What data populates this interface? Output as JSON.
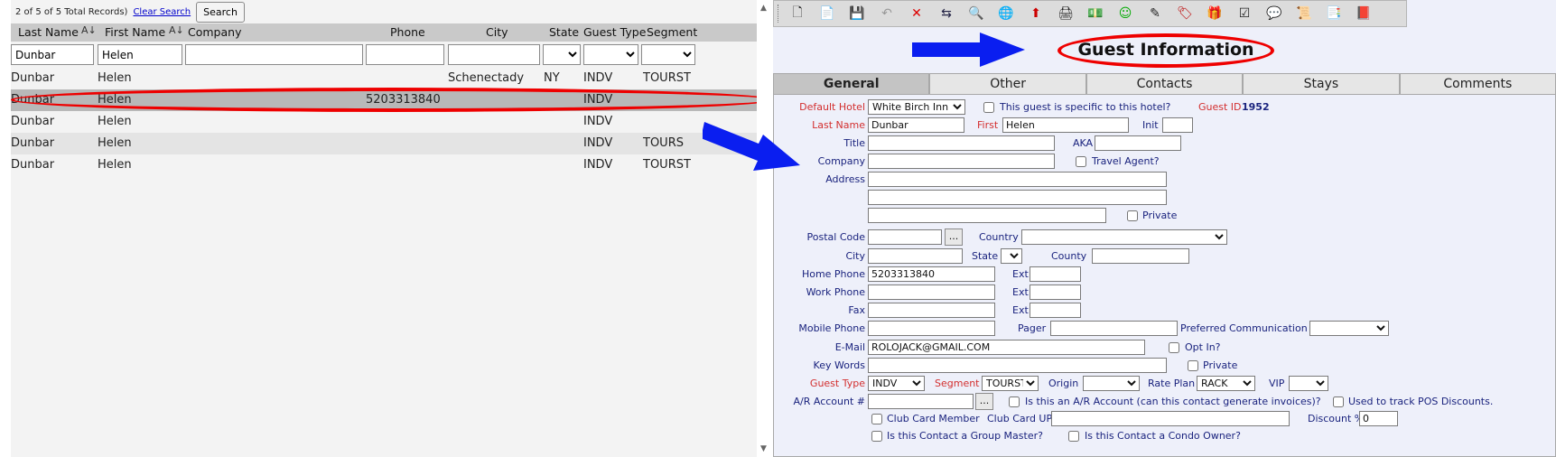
{
  "left": {
    "record_info": "2 of 5 of 5 Total Records)",
    "clear_search": "Clear Search",
    "search_button": "Search",
    "columns": [
      "Last Name",
      "First Name",
      "Company",
      "Phone",
      "City",
      "State",
      "Guest Type",
      "Segment"
    ],
    "filters": {
      "last_name": "Dunbar",
      "first_name": "Helen"
    },
    "rows": [
      {
        "last": "Dunbar",
        "first": "Helen",
        "company": "",
        "phone": "",
        "city": "Schenectady",
        "state": "NY",
        "type": "INDV",
        "segment": "TOURST"
      },
      {
        "last": "Dunbar",
        "first": "Helen",
        "company": "",
        "phone": "5203313840",
        "city": "",
        "state": "",
        "type": "INDV",
        "segment": ""
      },
      {
        "last": "Dunbar",
        "first": "Helen",
        "company": "",
        "phone": "",
        "city": "",
        "state": "",
        "type": "INDV",
        "segment": ""
      },
      {
        "last": "Dunbar",
        "first": "Helen",
        "company": "",
        "phone": "",
        "city": "",
        "state": "",
        "type": "INDV",
        "segment": "TOURS"
      },
      {
        "last": "Dunbar",
        "first": "Helen",
        "company": "",
        "phone": "",
        "city": "",
        "state": "",
        "type": "INDV",
        "segment": "TOURST"
      }
    ]
  },
  "right": {
    "title": "Guest Information",
    "toolbar_icons": [
      "new-icon",
      "copy-icon",
      "save-icon",
      "undo-icon",
      "delete-icon",
      "merge-icon",
      "find-icon",
      "globe-icon",
      "export-icon",
      "print-icon",
      "money-icon",
      "smiley-icon",
      "wand-icon",
      "tag-icon",
      "gift-icon",
      "checklist-icon",
      "comment-icon",
      "scroll-icon",
      "documents-icon",
      "book-icon"
    ],
    "tabs": [
      "General",
      "Other",
      "Contacts",
      "Stays",
      "Comments"
    ],
    "form": {
      "default_hotel_label": "Default Hotel",
      "default_hotel_value": "White Birch Inn",
      "specific_label": "This guest is specific to this hotel?",
      "guest_id_label": "Guest ID",
      "guest_id_value": "1952",
      "last_name_label": "Last Name",
      "last_name_value": "Dunbar",
      "first_label": "First",
      "first_value": "Helen",
      "init_label": "Init",
      "title_label": "Title",
      "aka_label": "AKA",
      "company_label": "Company",
      "travel_agent_label": "Travel Agent?",
      "address_label": "Address",
      "private_label": "Private",
      "postal_code_label": "Postal Code",
      "country_label": "Country",
      "city_label": "City",
      "state_label": "State",
      "county_label": "County",
      "home_phone_label": "Home Phone",
      "home_phone_value": "5203313840",
      "ext_label": "Ext",
      "work_phone_label": "Work Phone",
      "fax_label": "Fax",
      "mobile_phone_label": "Mobile Phone",
      "pager_label": "Pager",
      "pref_comm_label": "Preferred Communication",
      "email_label": "E-Mail",
      "email_value": "ROLOJACK@GMAIL.COM",
      "opt_in_label": "Opt In?",
      "key_words_label": "Key Words",
      "guest_type_label": "Guest Type",
      "guest_type_value": "INDV",
      "segment_label": "Segment",
      "segment_value": "TOURST",
      "origin_label": "Origin",
      "rate_plan_label": "Rate Plan",
      "rate_plan_value": "RACK",
      "vip_label": "VIP",
      "ar_account_label": "A/R Account #",
      "ar_question": "Is this an A/R Account (can this contact generate invoices)?",
      "pos_label": "Used to track POS Discounts.",
      "club_card_label": "Club Card Member",
      "club_card_upc_label": "Club Card UPC",
      "discount_label": "Discount %",
      "discount_value": "0",
      "group_master_label": "Is this Contact a Group Master?",
      "condo_owner_label": "Is this Contact a Condo Owner?",
      "dots": "..."
    }
  },
  "colors": {
    "highlight": "#e00000",
    "arrow": "#0a1ef0",
    "label": "#1a237e",
    "required": "#d32f2f"
  }
}
